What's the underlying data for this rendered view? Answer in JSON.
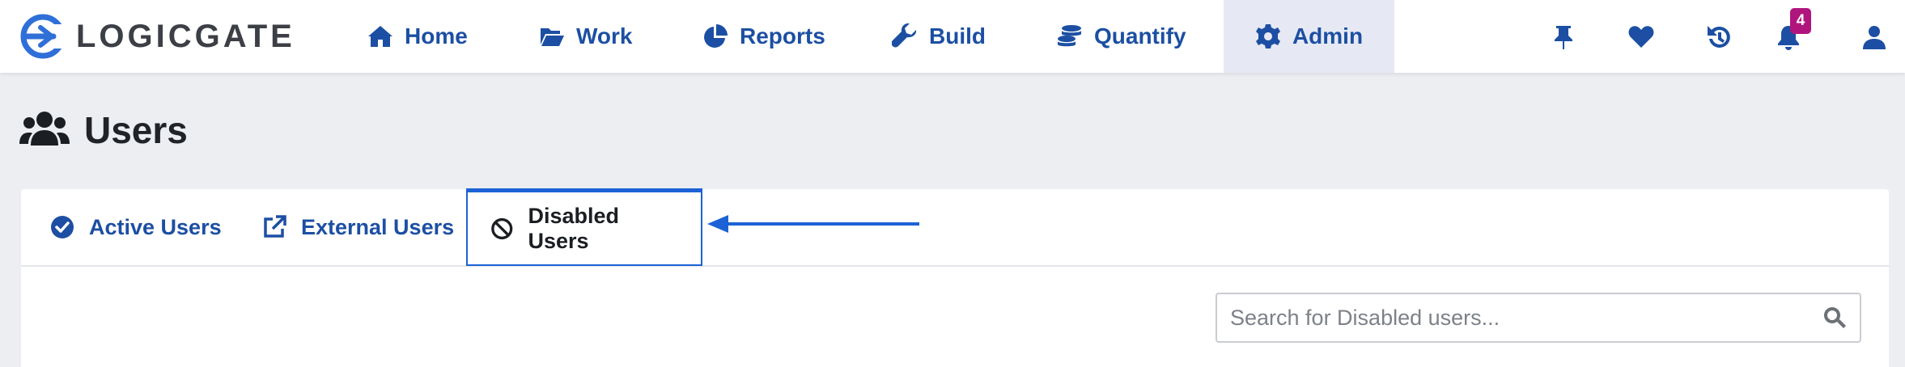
{
  "app": {
    "logo_text": "LOGICGATE"
  },
  "nav": {
    "items": [
      {
        "label": "Home",
        "icon": "home-icon"
      },
      {
        "label": "Work",
        "icon": "folder-open-icon"
      },
      {
        "label": "Reports",
        "icon": "pie-chart-icon"
      },
      {
        "label": "Build",
        "icon": "wrench-icon"
      },
      {
        "label": "Quantify",
        "icon": "coins-icon"
      },
      {
        "label": "Admin",
        "icon": "gear-icon",
        "active": true
      }
    ],
    "right_icons": [
      "pin-icon",
      "heart-icon",
      "history-icon",
      "bell-icon",
      "user-icon"
    ],
    "notification_count": "4"
  },
  "page": {
    "title": "Users",
    "title_icon": "users-icon"
  },
  "tabs": [
    {
      "label": "Active Users",
      "icon": "check-circle-icon"
    },
    {
      "label": "External Users",
      "icon": "external-link-icon"
    },
    {
      "label": "Disabled Users",
      "icon": "ban-icon",
      "selected": true
    }
  ],
  "search": {
    "placeholder": "Search for Disabled users...",
    "value": ""
  },
  "colors": {
    "accent": "#1c4fa3",
    "selected_border": "#1c62d6",
    "badge": "#b0157e",
    "annotation_arrow": "#1c62d6"
  }
}
